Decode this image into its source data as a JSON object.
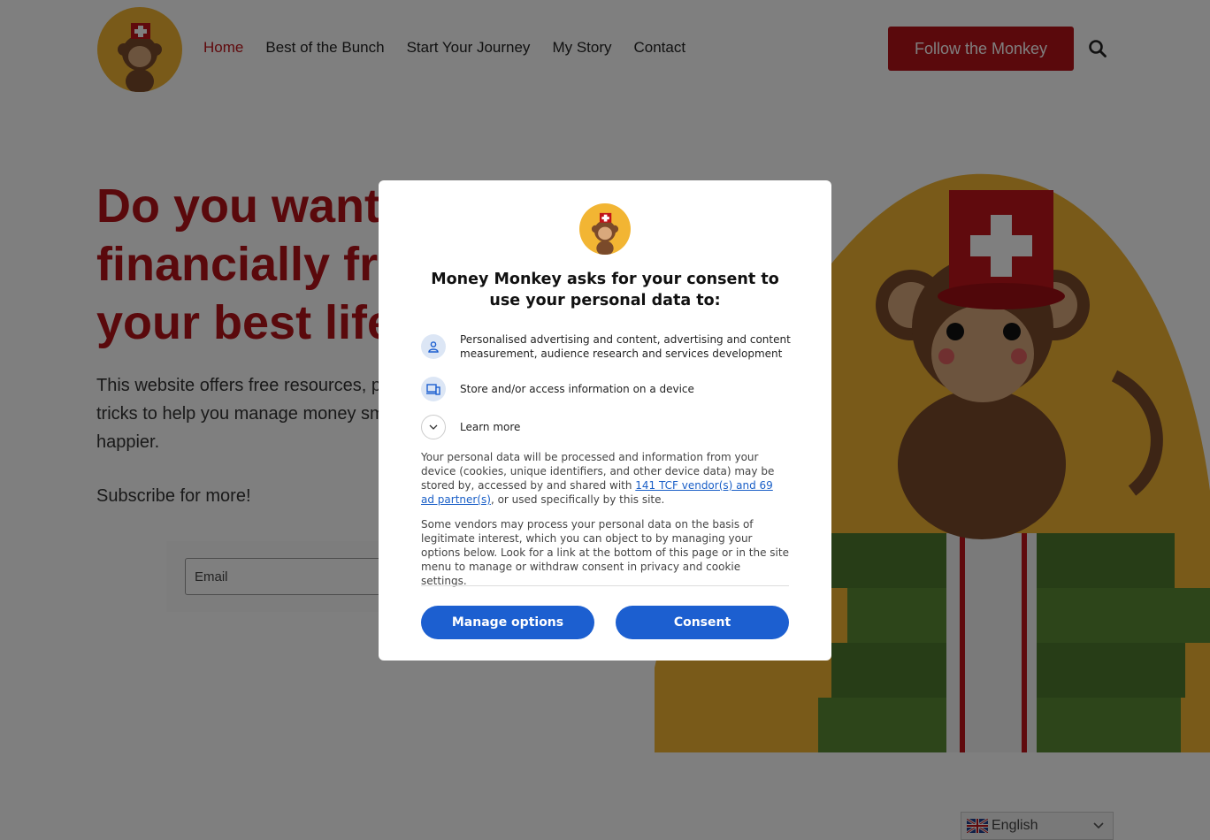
{
  "header": {
    "nav": [
      {
        "label": "Home",
        "active": true
      },
      {
        "label": "Best of the Bunch"
      },
      {
        "label": "Start Your Journey"
      },
      {
        "label": "My Story"
      },
      {
        "label": "Contact"
      }
    ],
    "cta_label": "Follow the Monkey",
    "search_icon": "search-icon"
  },
  "hero": {
    "title": "Do you want to be financially free and live your best life?",
    "text": "This website offers free resources, personal finance tips & tricks to help you manage money smarter, and be overall happier.",
    "subscribe": "Subscribe for more!",
    "email_placeholder": "Email"
  },
  "language": {
    "flag": "uk-flag-icon",
    "label": "English"
  },
  "consent": {
    "title": "Money Monkey asks for your consent to use your personal data to:",
    "purposes": [
      {
        "icon": "person-icon",
        "text": "Personalised advertising and content, advertising and content measurement, audience research and services development"
      },
      {
        "icon": "devices-icon",
        "text": "Store and/or access information on a device"
      }
    ],
    "learn_more": "Learn more",
    "para1_a": "Your personal data will be processed and information from your device (cookies, unique identifiers, and other device data) may be stored by, accessed by and shared with ",
    "para1_link": "141 TCF vendor(s) and 69 ad partner(s)",
    "para1_b": ", or used specifically by this site.",
    "para2": "Some vendors may process your personal data on the basis of legitimate interest, which you can object to by managing your options below. Look for a link at the bottom of this page or in the site menu to manage or withdraw consent in privacy and cookie settings.",
    "manage_label": "Manage options",
    "consent_label": "Consent"
  },
  "colors": {
    "brand_red": "#b51218",
    "brand_yellow": "#f2b533",
    "consent_blue": "#1c5fd0"
  }
}
